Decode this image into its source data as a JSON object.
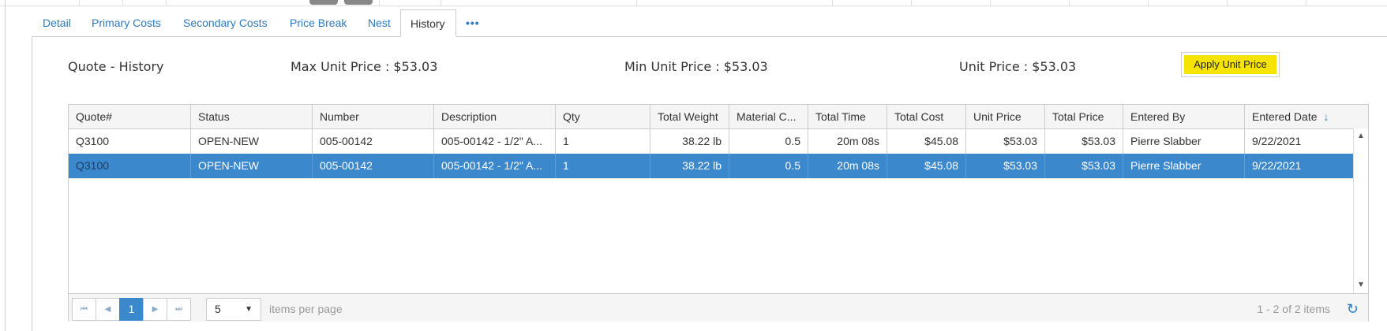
{
  "tabs": [
    {
      "label": "Detail"
    },
    {
      "label": "Primary Costs"
    },
    {
      "label": "Secondary Costs"
    },
    {
      "label": "Price Break"
    },
    {
      "label": "Nest"
    },
    {
      "label": "History"
    },
    {
      "label": "•••"
    }
  ],
  "active_tab": "History",
  "header": {
    "title": "Quote - History",
    "max_unit_price": "Max Unit Price : $53.03",
    "min_unit_price": "Min Unit Price : $53.03",
    "unit_price": "Unit Price : $53.03",
    "apply_button": "Apply Unit Price"
  },
  "grid": {
    "columns": [
      "Quote#",
      "Status",
      "Number",
      "Description",
      "Qty",
      "Total Weight",
      "Material C...",
      "Total Time",
      "Total Cost",
      "Unit Price",
      "Total Price",
      "Entered By",
      "Entered Date"
    ],
    "sort_icon": "arrow-down-icon",
    "rows": [
      [
        "Q3100",
        "OPEN-NEW",
        "005-00142",
        "005-00142 - 1/2\" A...",
        "1",
        "38.22 lb",
        "0.5",
        "20m 08s",
        "$45.08",
        "$53.03",
        "$53.03",
        "Pierre Slabber",
        "9/22/2021"
      ],
      [
        "Q3100",
        "OPEN-NEW",
        "005-00142",
        "005-00142 - 1/2\" A...",
        "1",
        "38.22 lb",
        "0.5",
        "20m 08s",
        "$45.08",
        "$53.03",
        "$53.03",
        "Pierre Slabber",
        "9/22/2021"
      ]
    ],
    "selected_row": 1
  },
  "pager": {
    "current_page": "1",
    "page_size": "5",
    "items_per_page": "items per page",
    "info": "1 - 2 of 2 items"
  },
  "colors": {
    "accent": "#2e7bc4",
    "selected_row": "#3b88cc",
    "apply_button": "#f7e300"
  }
}
